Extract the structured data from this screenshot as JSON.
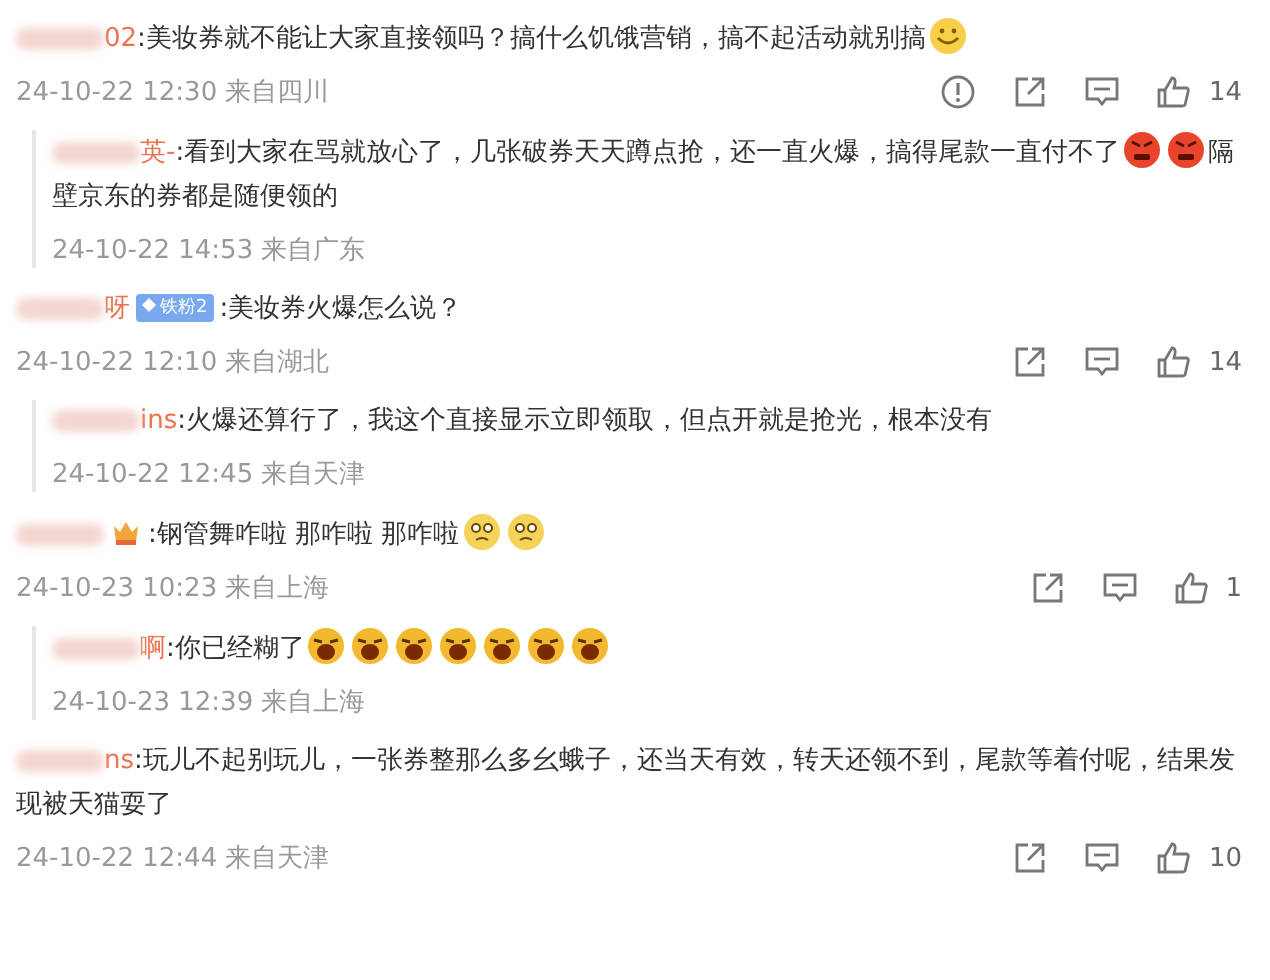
{
  "comments": [
    {
      "author": "02",
      "segments": [
        {
          "kind": "text",
          "text": ":美妆券就不能让大家直接领吗？搞什么饥饿营销，搞不起活动就别搞"
        },
        {
          "kind": "smile"
        }
      ],
      "time": "24-10-22 12:30 来自四川",
      "actions": [
        {
          "kind": "report"
        },
        {
          "kind": "share"
        },
        {
          "kind": "comment"
        },
        {
          "kind": "like",
          "count": "14"
        }
      ],
      "replies": [
        {
          "author": "英-",
          "segments": [
            {
              "kind": "text",
              "text": ":看到大家在骂就放心了，几张破券天天蹲点抢，还一直火爆，搞得尾款一直付不了"
            },
            {
              "kind": "angry"
            },
            {
              "kind": "angry"
            },
            {
              "kind": "text",
              "text": "隔壁京东的券都是随便领的"
            }
          ],
          "time": "24-10-22 14:53 来自广东"
        }
      ]
    },
    {
      "author": "呀",
      "author_badge": {
        "kind": "fan",
        "text": "铁粉2"
      },
      "segments": [
        {
          "kind": "text",
          "text": ":美妆券火爆怎么说？"
        }
      ],
      "time": "24-10-22 12:10 来自湖北",
      "actions": [
        {
          "kind": "share"
        },
        {
          "kind": "comment"
        },
        {
          "kind": "like",
          "count": "14"
        }
      ],
      "replies": [
        {
          "author": "ins",
          "segments": [
            {
              "kind": "text",
              "text": ":火爆还算行了，我这个直接显示立即领取，但点开就是抢光，根本没有"
            }
          ],
          "time": "24-10-22 12:45 来自天津"
        }
      ]
    },
    {
      "author_badge": {
        "kind": "crown"
      },
      "segments": [
        {
          "kind": "text",
          "text": ":钢管舞咋啦 那咋啦 那咋啦"
        },
        {
          "kind": "sigh"
        },
        {
          "kind": "sigh"
        }
      ],
      "time": "24-10-23 10:23 来自上海",
      "actions": [
        {
          "kind": "share"
        },
        {
          "kind": "comment"
        },
        {
          "kind": "like",
          "count": "1"
        }
      ],
      "replies": [
        {
          "author": "啊",
          "segments": [
            {
              "kind": "text",
              "text": ":你已经糊了"
            },
            {
              "kind": "cry"
            },
            {
              "kind": "cry"
            },
            {
              "kind": "cry"
            },
            {
              "kind": "cry"
            },
            {
              "kind": "cry"
            },
            {
              "kind": "cry"
            },
            {
              "kind": "cry"
            }
          ],
          "time": "24-10-23 12:39 来自上海"
        }
      ]
    },
    {
      "author": "ns",
      "segments": [
        {
          "kind": "text",
          "text": ":玩儿不起别玩儿，一张券整那么多幺蛾子，还当天有效，转天还领不到，尾款等着付呢，结果发现被天猫耍了"
        }
      ],
      "time": "24-10-22 12:44 来自天津",
      "actions": [
        {
          "kind": "share"
        },
        {
          "kind": "comment"
        },
        {
          "kind": "like",
          "count": "10"
        }
      ]
    }
  ]
}
